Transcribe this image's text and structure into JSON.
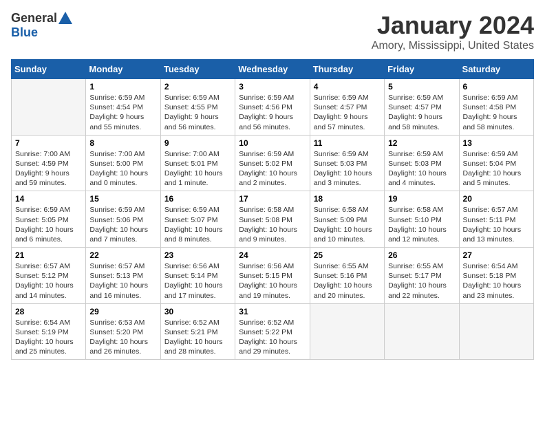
{
  "header": {
    "logo_general": "General",
    "logo_blue": "Blue",
    "month_title": "January 2024",
    "location": "Amory, Mississippi, United States"
  },
  "days_of_week": [
    "Sunday",
    "Monday",
    "Tuesday",
    "Wednesday",
    "Thursday",
    "Friday",
    "Saturday"
  ],
  "weeks": [
    [
      {
        "day": "",
        "empty": true
      },
      {
        "day": "1",
        "sunrise": "6:59 AM",
        "sunset": "4:54 PM",
        "daylight": "9 hours and 55 minutes."
      },
      {
        "day": "2",
        "sunrise": "6:59 AM",
        "sunset": "4:55 PM",
        "daylight": "9 hours and 56 minutes."
      },
      {
        "day": "3",
        "sunrise": "6:59 AM",
        "sunset": "4:56 PM",
        "daylight": "9 hours and 56 minutes."
      },
      {
        "day": "4",
        "sunrise": "6:59 AM",
        "sunset": "4:57 PM",
        "daylight": "9 hours and 57 minutes."
      },
      {
        "day": "5",
        "sunrise": "6:59 AM",
        "sunset": "4:57 PM",
        "daylight": "9 hours and 58 minutes."
      },
      {
        "day": "6",
        "sunrise": "6:59 AM",
        "sunset": "4:58 PM",
        "daylight": "9 hours and 58 minutes."
      }
    ],
    [
      {
        "day": "7",
        "sunrise": "7:00 AM",
        "sunset": "4:59 PM",
        "daylight": "9 hours and 59 minutes."
      },
      {
        "day": "8",
        "sunrise": "7:00 AM",
        "sunset": "5:00 PM",
        "daylight": "10 hours and 0 minutes."
      },
      {
        "day": "9",
        "sunrise": "7:00 AM",
        "sunset": "5:01 PM",
        "daylight": "10 hours and 1 minute."
      },
      {
        "day": "10",
        "sunrise": "6:59 AM",
        "sunset": "5:02 PM",
        "daylight": "10 hours and 2 minutes."
      },
      {
        "day": "11",
        "sunrise": "6:59 AM",
        "sunset": "5:03 PM",
        "daylight": "10 hours and 3 minutes."
      },
      {
        "day": "12",
        "sunrise": "6:59 AM",
        "sunset": "5:03 PM",
        "daylight": "10 hours and 4 minutes."
      },
      {
        "day": "13",
        "sunrise": "6:59 AM",
        "sunset": "5:04 PM",
        "daylight": "10 hours and 5 minutes."
      }
    ],
    [
      {
        "day": "14",
        "sunrise": "6:59 AM",
        "sunset": "5:05 PM",
        "daylight": "10 hours and 6 minutes."
      },
      {
        "day": "15",
        "sunrise": "6:59 AM",
        "sunset": "5:06 PM",
        "daylight": "10 hours and 7 minutes."
      },
      {
        "day": "16",
        "sunrise": "6:59 AM",
        "sunset": "5:07 PM",
        "daylight": "10 hours and 8 minutes."
      },
      {
        "day": "17",
        "sunrise": "6:58 AM",
        "sunset": "5:08 PM",
        "daylight": "10 hours and 9 minutes."
      },
      {
        "day": "18",
        "sunrise": "6:58 AM",
        "sunset": "5:09 PM",
        "daylight": "10 hours and 10 minutes."
      },
      {
        "day": "19",
        "sunrise": "6:58 AM",
        "sunset": "5:10 PM",
        "daylight": "10 hours and 12 minutes."
      },
      {
        "day": "20",
        "sunrise": "6:57 AM",
        "sunset": "5:11 PM",
        "daylight": "10 hours and 13 minutes."
      }
    ],
    [
      {
        "day": "21",
        "sunrise": "6:57 AM",
        "sunset": "5:12 PM",
        "daylight": "10 hours and 14 minutes."
      },
      {
        "day": "22",
        "sunrise": "6:57 AM",
        "sunset": "5:13 PM",
        "daylight": "10 hours and 16 minutes."
      },
      {
        "day": "23",
        "sunrise": "6:56 AM",
        "sunset": "5:14 PM",
        "daylight": "10 hours and 17 minutes."
      },
      {
        "day": "24",
        "sunrise": "6:56 AM",
        "sunset": "5:15 PM",
        "daylight": "10 hours and 19 minutes."
      },
      {
        "day": "25",
        "sunrise": "6:55 AM",
        "sunset": "5:16 PM",
        "daylight": "10 hours and 20 minutes."
      },
      {
        "day": "26",
        "sunrise": "6:55 AM",
        "sunset": "5:17 PM",
        "daylight": "10 hours and 22 minutes."
      },
      {
        "day": "27",
        "sunrise": "6:54 AM",
        "sunset": "5:18 PM",
        "daylight": "10 hours and 23 minutes."
      }
    ],
    [
      {
        "day": "28",
        "sunrise": "6:54 AM",
        "sunset": "5:19 PM",
        "daylight": "10 hours and 25 minutes."
      },
      {
        "day": "29",
        "sunrise": "6:53 AM",
        "sunset": "5:20 PM",
        "daylight": "10 hours and 26 minutes."
      },
      {
        "day": "30",
        "sunrise": "6:52 AM",
        "sunset": "5:21 PM",
        "daylight": "10 hours and 28 minutes."
      },
      {
        "day": "31",
        "sunrise": "6:52 AM",
        "sunset": "5:22 PM",
        "daylight": "10 hours and 29 minutes."
      },
      {
        "day": "",
        "empty": true
      },
      {
        "day": "",
        "empty": true
      },
      {
        "day": "",
        "empty": true
      }
    ]
  ]
}
